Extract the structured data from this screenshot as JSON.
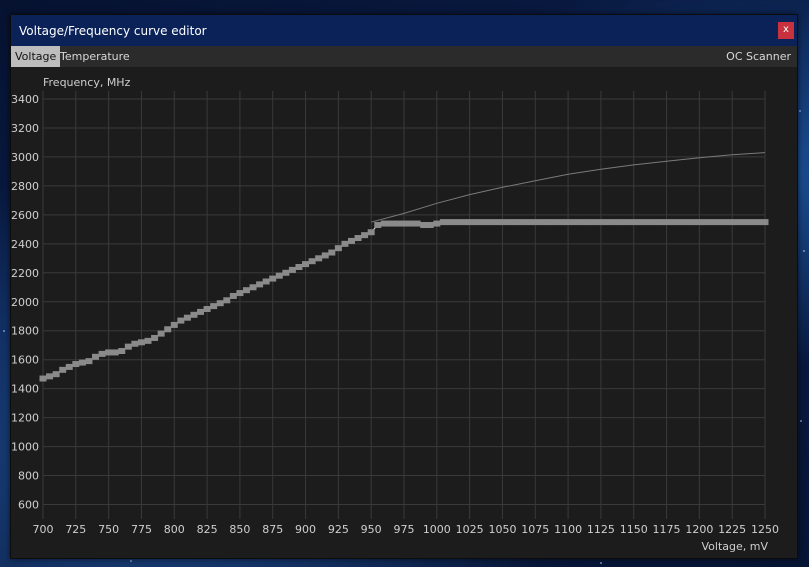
{
  "window": {
    "title": "Voltage/Frequency curve editor",
    "close_label": "x"
  },
  "tabs": {
    "voltage": "Voltage",
    "temperature": "Temperature",
    "oc_scanner": "OC Scanner"
  },
  "colors": {
    "title_bar": "#0a2258",
    "plot_bg": "#1c1c1c",
    "grid": "#3a3a3a",
    "curve": "#e6e6e6",
    "points": "#8a8a8a",
    "reference": "#7a7a7a",
    "close": "#c8323e"
  },
  "chart_data": {
    "type": "line",
    "ylabel": "Frequency, MHz",
    "xlabel": "Voltage, mV",
    "xlim": [
      700,
      1250
    ],
    "ylim": [
      500,
      3400
    ],
    "xticks": [
      700,
      725,
      750,
      775,
      800,
      825,
      850,
      875,
      900,
      925,
      950,
      975,
      1000,
      1025,
      1050,
      1075,
      1100,
      1125,
      1150,
      1175,
      1200,
      1225,
      1250
    ],
    "yticks": [
      600,
      800,
      1000,
      1200,
      1400,
      1600,
      1800,
      2000,
      2200,
      2400,
      2600,
      2800,
      3000,
      3200,
      3400
    ],
    "grid": true,
    "series": [
      {
        "role": "reference",
        "x": [
          950,
          975,
          1000,
          1025,
          1050,
          1075,
          1100,
          1125,
          1150,
          1175,
          1200,
          1225,
          1250
        ],
        "y": [
          2550,
          2610,
          2680,
          2740,
          2790,
          2835,
          2880,
          2915,
          2945,
          2970,
          2995,
          3015,
          3030
        ]
      },
      {
        "role": "curve",
        "x": [
          700,
          705,
          710,
          715,
          720,
          725,
          730,
          735,
          740,
          745,
          750,
          755,
          760,
          765,
          770,
          775,
          780,
          785,
          790,
          795,
          800,
          805,
          810,
          815,
          820,
          825,
          830,
          835,
          840,
          845,
          850,
          855,
          860,
          865,
          870,
          875,
          880,
          885,
          890,
          895,
          900,
          905,
          910,
          915,
          920,
          925,
          930,
          935,
          940,
          945,
          950,
          955,
          960,
          965,
          970,
          975,
          980,
          985,
          990,
          995,
          1000,
          1005,
          1010,
          1015,
          1020,
          1025,
          1030,
          1035,
          1040,
          1045,
          1050,
          1055,
          1060,
          1065,
          1070,
          1075,
          1080,
          1085,
          1090,
          1095,
          1100,
          1105,
          1110,
          1115,
          1120,
          1125,
          1130,
          1135,
          1140,
          1145,
          1150,
          1155,
          1160,
          1165,
          1170,
          1175,
          1180,
          1185,
          1190,
          1195,
          1200,
          1205,
          1210,
          1215,
          1220,
          1225,
          1230,
          1235,
          1240,
          1245,
          1250
        ],
        "y": [
          1470,
          1485,
          1500,
          1530,
          1550,
          1570,
          1580,
          1590,
          1620,
          1640,
          1650,
          1650,
          1660,
          1690,
          1710,
          1720,
          1730,
          1750,
          1780,
          1810,
          1840,
          1870,
          1890,
          1910,
          1930,
          1950,
          1970,
          1990,
          2010,
          2040,
          2060,
          2080,
          2100,
          2120,
          2140,
          2160,
          2180,
          2200,
          2220,
          2240,
          2260,
          2280,
          2300,
          2320,
          2340,
          2370,
          2400,
          2420,
          2440,
          2460,
          2480,
          2530,
          2540,
          2540,
          2540,
          2540,
          2540,
          2540,
          2530,
          2530,
          2540,
          2550,
          2550,
          2550,
          2550,
          2550,
          2550,
          2550,
          2550,
          2550,
          2550,
          2550,
          2550,
          2550,
          2550,
          2550,
          2550,
          2550,
          2550,
          2550,
          2550,
          2550,
          2550,
          2550,
          2550,
          2550,
          2550,
          2550,
          2550,
          2550,
          2550,
          2550,
          2550,
          2550,
          2550,
          2550,
          2550,
          2550,
          2550,
          2550,
          2550,
          2550,
          2550,
          2550,
          2550,
          2550,
          2550,
          2550,
          2550,
          2550,
          2550
        ]
      }
    ]
  }
}
